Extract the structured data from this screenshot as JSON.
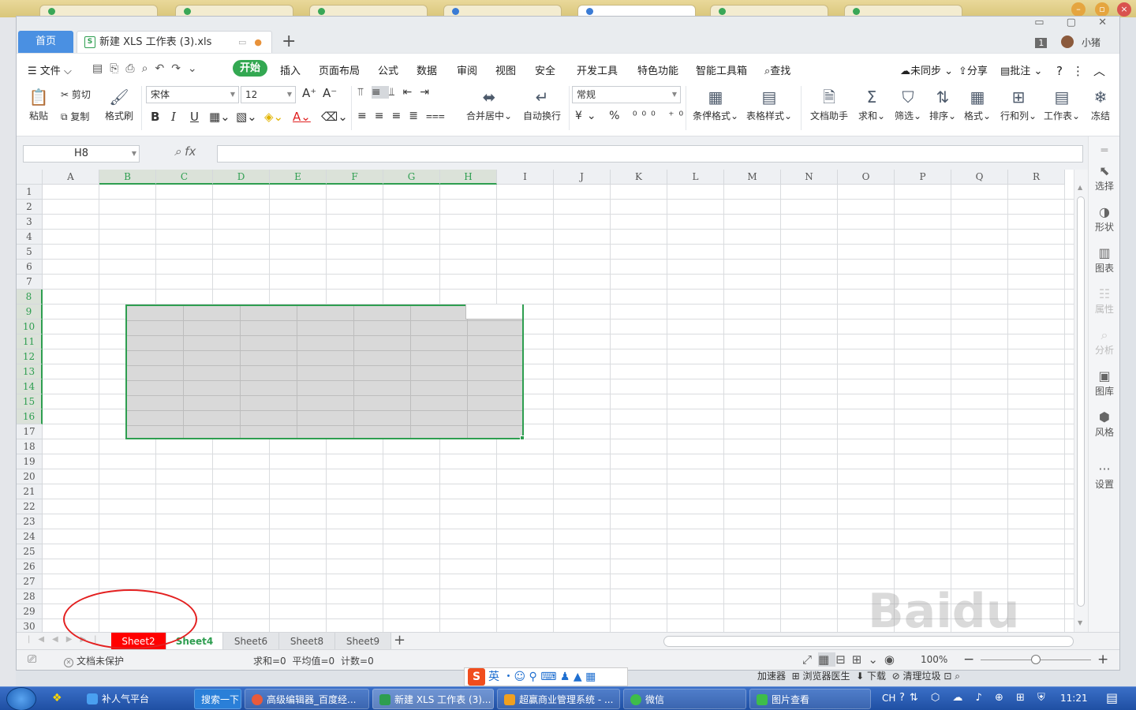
{
  "browser": {
    "tab_count": 7
  },
  "window": {
    "home_tab": "首页",
    "doc_tab": "新建 XLS 工作表 (3).xls",
    "user_count": "1",
    "user_name": "小猪"
  },
  "menu": {
    "file": "文件",
    "items": [
      "开始",
      "插入",
      "页面布局",
      "公式",
      "数据",
      "审阅",
      "视图",
      "安全",
      "开发工具",
      "特色功能",
      "智能工具箱",
      "查找"
    ],
    "right": [
      "未同步",
      "分享",
      "批注"
    ]
  },
  "ribbon": {
    "paste": "粘贴",
    "cut": "剪切",
    "copy": "复制",
    "format_painter": "格式刷",
    "font_name": "宋体",
    "font_size": "12",
    "merge": "合并居中",
    "wrap": "自动换行",
    "number_format": "常规",
    "cond_format": "条件格式",
    "table_style": "表格样式",
    "doc_helper": "文档助手",
    "sum": "求和",
    "filter": "筛选",
    "sort": "排序",
    "format": "格式",
    "rowcol": "行和列",
    "worksheet": "工作表",
    "freeze": "冻结"
  },
  "formula_bar": {
    "name_box": "H8",
    "formula": ""
  },
  "columns": [
    "A",
    "B",
    "C",
    "D",
    "E",
    "F",
    "G",
    "H",
    "I",
    "J",
    "K",
    "L",
    "M",
    "N",
    "O",
    "P",
    "Q",
    "R"
  ],
  "selected_columns": [
    "B",
    "C",
    "D",
    "E",
    "F",
    "G",
    "H"
  ],
  "rows": [
    "1",
    "2",
    "3",
    "4",
    "5",
    "6",
    "7",
    "8",
    "9",
    "10",
    "11",
    "12",
    "13",
    "14",
    "15",
    "16",
    "17",
    "18",
    "19",
    "20",
    "21",
    "22",
    "23",
    "24",
    "25",
    "26",
    "27",
    "28",
    "29",
    "30"
  ],
  "selected_rows": [
    "8",
    "9",
    "10",
    "11",
    "12",
    "13",
    "14",
    "15",
    "16"
  ],
  "side_panel": [
    "选择",
    "形状",
    "图表",
    "属性",
    "分析",
    "图库",
    "风格",
    "设置"
  ],
  "sheets": [
    "Sheet2",
    "Sheet4",
    "Sheet6",
    "Sheet8",
    "Sheet9"
  ],
  "active_sheet": "Sheet4",
  "status": {
    "protection": "文档未保护",
    "stats": "求和=0  平均值=0  计数=0",
    "zoom": "100%"
  },
  "taskbar": {
    "items": [
      "补人气平台",
      "搜索一下",
      "高级编辑器_百度经...",
      "新建 XLS 工作表 (3)...",
      "超赢商业管理系统 - ...",
      "微信",
      "图片查看"
    ],
    "clock": "11:21",
    "lang": "CH"
  },
  "ime": {
    "mode": "英"
  },
  "browser_status": {
    "accel": "加速器",
    "browser_doctor": "浏览器医生",
    "download": "下载",
    "clean": "清理垃圾"
  },
  "colors": {
    "accent_green": "#2e9e50",
    "home_blue": "#4a90e2",
    "sheet_red": "#ff0000",
    "annotation_red": "#e32020"
  }
}
